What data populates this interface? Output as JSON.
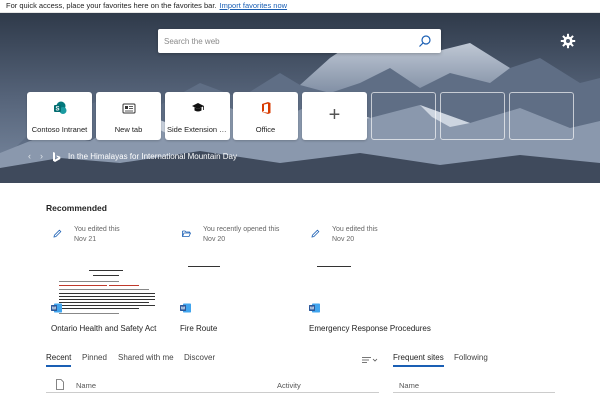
{
  "favorites_bar": {
    "message": "For quick access, place your favorites here on the favorites bar.",
    "import_link": "Import favorites now"
  },
  "search": {
    "placeholder": "Search the web",
    "icon": "search-icon"
  },
  "settings": {
    "icon": "gear-icon"
  },
  "tiles": [
    {
      "label": "Contoso Intranet",
      "icon": "sharepoint-icon"
    },
    {
      "label": "New tab",
      "icon": "news-icon"
    },
    {
      "label": "Side Extension S...",
      "icon": "graduation-cap-icon"
    },
    {
      "label": "Office",
      "icon": "office-icon"
    },
    {
      "label": "+",
      "icon": "plus-icon"
    }
  ],
  "image_caption": {
    "text": "In the Himalayas for International Mountain Day",
    "prev": "‹",
    "next": "›"
  },
  "recommended": {
    "title": "Recommended",
    "cards": [
      {
        "action": "You edited this",
        "date": "Nov 21",
        "name": "Ontario Health and Safety Act",
        "icon": "pencil-icon"
      },
      {
        "action": "You recently opened this",
        "date": "Nov 20",
        "name": "Fire Route",
        "icon": "folder-open-icon"
      },
      {
        "action": "You edited this",
        "date": "Nov 20",
        "name": "Emergency Response Procedures",
        "icon": "pencil-icon"
      }
    ]
  },
  "file_tabs": [
    {
      "label": "Recent",
      "active": true
    },
    {
      "label": "Pinned",
      "active": false
    },
    {
      "label": "Shared with me",
      "active": false
    },
    {
      "label": "Discover",
      "active": false
    }
  ],
  "sites_tabs": [
    {
      "label": "Frequent sites",
      "active": true
    },
    {
      "label": "Following",
      "active": false
    }
  ],
  "file_list": {
    "columns": {
      "name": "Name",
      "activity": "Activity"
    }
  },
  "sites_list": {
    "columns": {
      "name": "Name"
    }
  },
  "colors": {
    "accent": "#1a5fb4",
    "word_blue": "#2b579a",
    "office_orange": "#d83b01",
    "sharepoint_teal": "#03787c"
  }
}
